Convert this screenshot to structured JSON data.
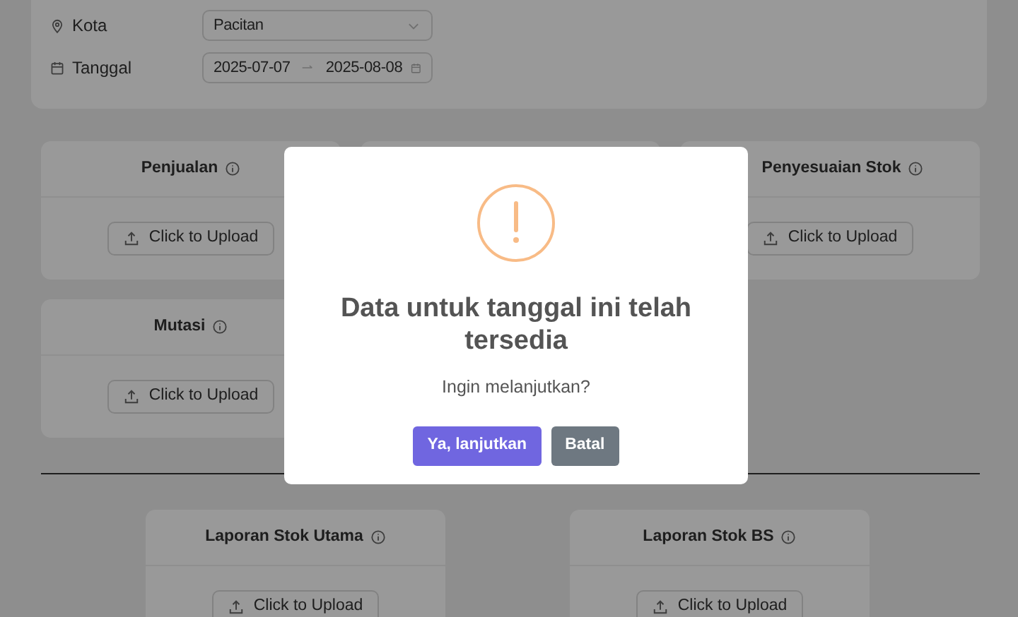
{
  "filters": [
    {
      "kind": "select",
      "label": "Kota",
      "value": "Pacitan"
    },
    {
      "kind": "daterange",
      "label": "Tanggal",
      "start": "2025-07-07",
      "end": "2025-08-08"
    }
  ],
  "upload_groups": [
    {
      "cards": [
        {
          "kind": "upload",
          "title": "Penjualan",
          "button": "Click to Upload"
        },
        {
          "kind": "covered"
        },
        {
          "kind": "upload",
          "title": "Penyesuaian Stok",
          "button": "Click to Upload"
        },
        {
          "kind": "upload",
          "title": "Mutasi",
          "button": "Click to Upload"
        }
      ]
    },
    {
      "cards": [
        {
          "kind": "upload",
          "title": "Laporan Stok Utama",
          "button": "Click to Upload"
        },
        {
          "kind": "upload",
          "title": "Laporan Stok BS",
          "button": "Click to Upload"
        }
      ]
    }
  ],
  "dialog": {
    "title": "Data untuk tanggal ini telah tersedia",
    "text": "Ingin melanjutkan?",
    "buttons": [
      {
        "kind": "confirm",
        "label": "Ya, lanjutkan"
      },
      {
        "kind": "cancel",
        "label": "Batal"
      }
    ]
  }
}
